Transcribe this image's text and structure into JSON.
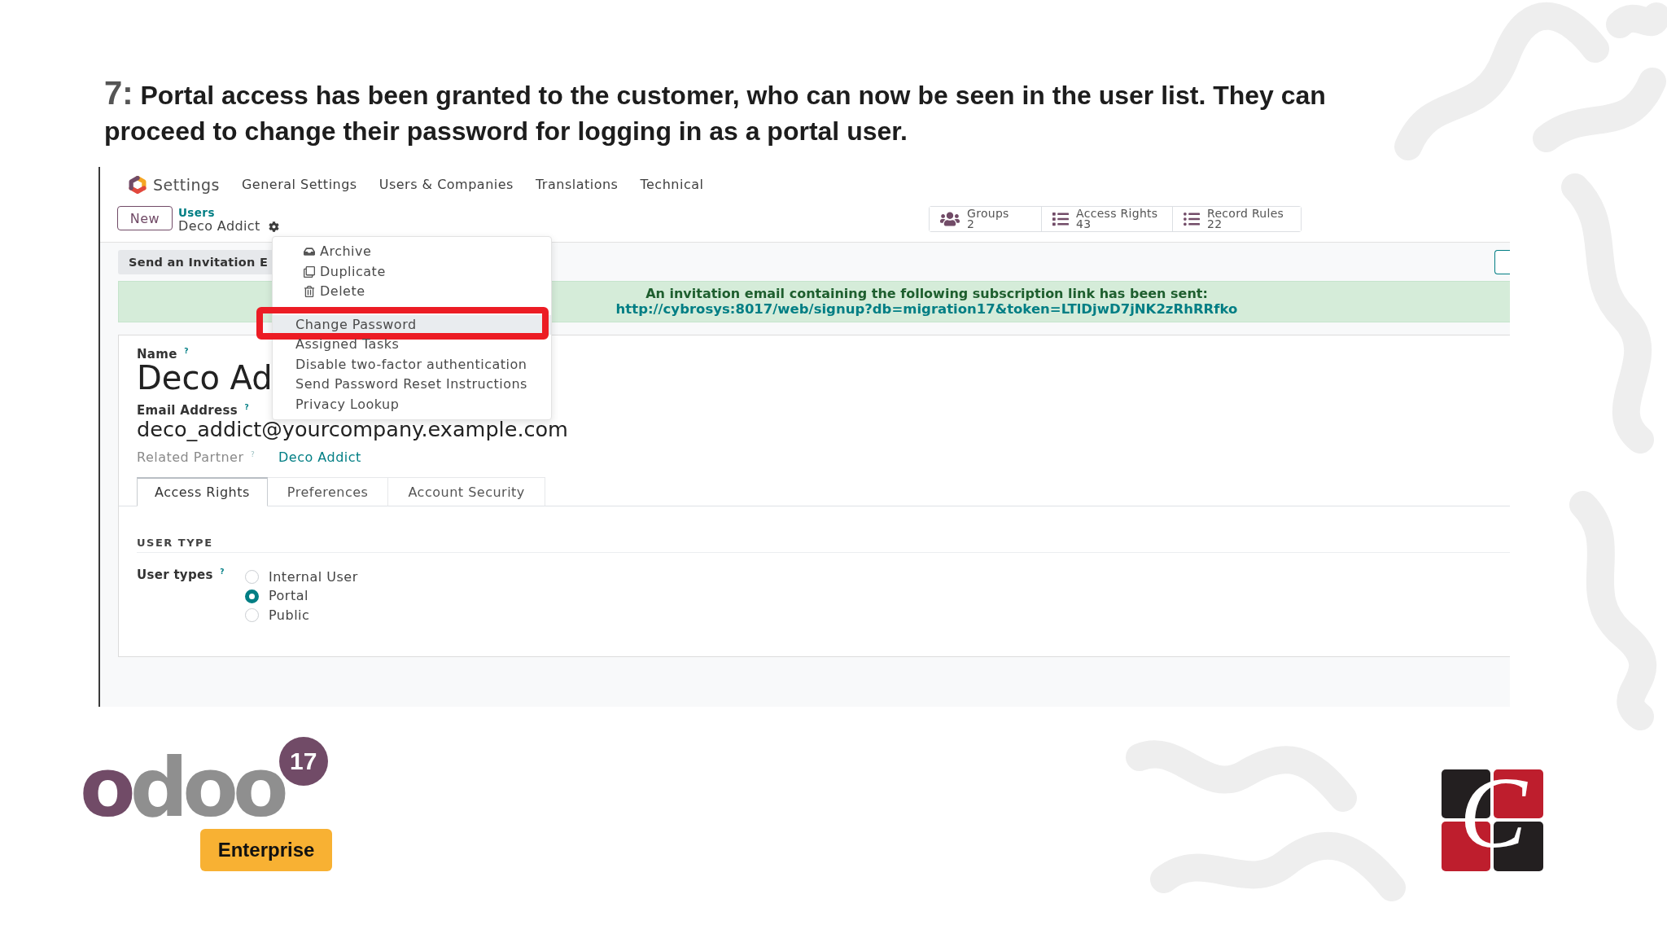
{
  "slide": {
    "step": "7:",
    "caption": "Portal access has been granted to the customer, who can now be seen in the user list. They can proceed to change their password for logging in as a portal user."
  },
  "app": {
    "navbar": {
      "app_name": "Settings",
      "menu": [
        "General Settings",
        "Users & Companies",
        "Translations",
        "Technical"
      ]
    },
    "control_panel": {
      "new_button": "New",
      "breadcrumb": {
        "parent": "Users",
        "current": "Deco Addict"
      },
      "smart_buttons": [
        {
          "kind": "users",
          "label": "Groups",
          "count": "2"
        },
        {
          "kind": "list",
          "label": "Access Rights",
          "count": "43"
        },
        {
          "kind": "list_ul",
          "label": "Record Rules",
          "count": "22"
        }
      ]
    },
    "status_bar": {
      "button": "Send an Invitation E"
    },
    "alert": {
      "message": "An invitation email containing the following subscription link has been sent:",
      "link": "http://cybrosys:8017/web/signup?db=migration17&token=LTlDjwD7jNK2zRhRRfko"
    },
    "form": {
      "name_label": "Name $^{?}$",
      "name_value": "Deco Ad",
      "email_label": "Email Address $^{?}$",
      "email_value": "deco_addict@yourcompany.example.com",
      "partner_label": "Related Partner $^{?}$",
      "partner_value": "Deco Addict",
      "tabs": [
        {
          "label": "Access Rights",
          "selected": true
        },
        {
          "label": "Preferences",
          "selected": false
        },
        {
          "label": "Account Security",
          "selected": false
        }
      ],
      "section_title": "USER TYPE",
      "user_types": {
        "label": "User types $^{?}$",
        "options": [
          {
            "label": "Internal User",
            "selected": false
          },
          {
            "label": "Portal",
            "selected": true
          },
          {
            "label": "Public",
            "selected": false
          }
        ]
      }
    },
    "action_menu": {
      "groups": [
        {
          "items": [
            {
              "kind": "archive",
              "label": "Archive",
              "highlighted": false,
              "annotated": false
            },
            {
              "kind": "duplicate",
              "label": "Duplicate",
              "highlighted": false,
              "annotated": false
            },
            {
              "kind": "delete",
              "label": "Delete",
              "highlighted": false,
              "annotated": false
            }
          ]
        },
        {
          "items": [
            {
              "kind": "plain",
              "label": "Change Password",
              "highlighted": true,
              "annotated": true
            },
            {
              "kind": "plain",
              "label": "Assigned Tasks",
              "highlighted": false,
              "annotated": false
            },
            {
              "kind": "plain",
              "label": "Disable two-factor authentication",
              "highlighted": false,
              "annotated": false
            },
            {
              "kind": "plain",
              "label": "Send Password Reset Instructions",
              "highlighted": false,
              "annotated": false
            },
            {
              "kind": "plain",
              "label": "Privacy Lookup",
              "highlighted": false,
              "annotated": false
            }
          ]
        }
      ]
    }
  },
  "branding": {
    "wordmark": "odoo",
    "version": "17",
    "edition": "Enterprise",
    "monogram": "C"
  }
}
